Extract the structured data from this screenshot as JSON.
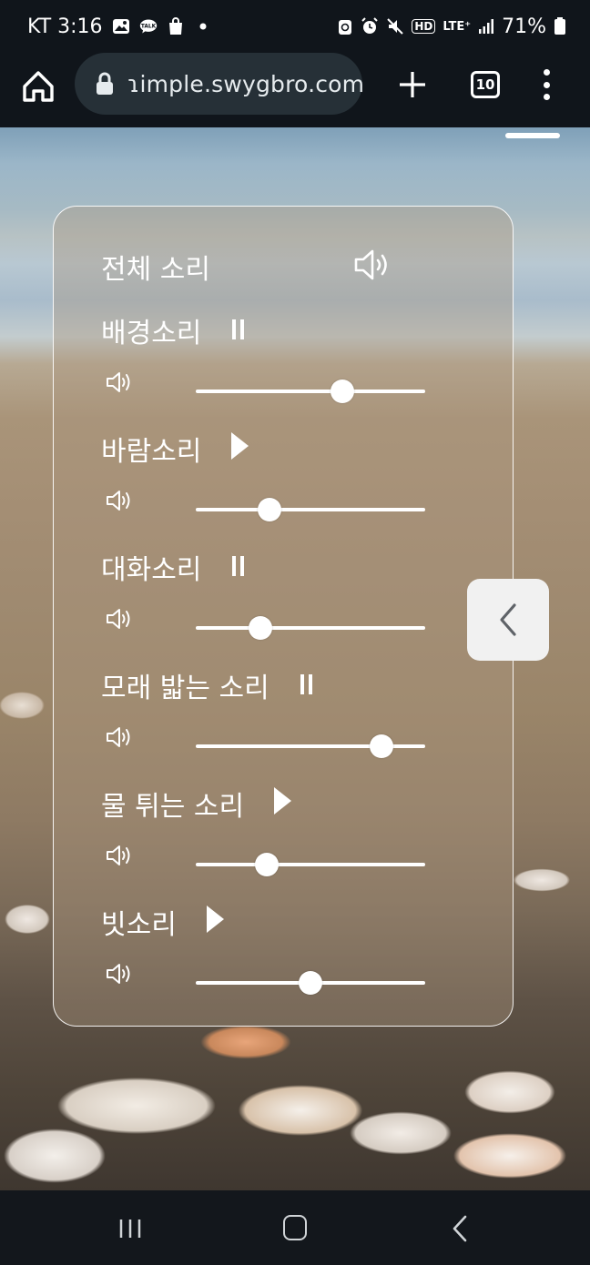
{
  "status_bar": {
    "carrier_time": "KT 3:16",
    "left_icons": [
      "gallery-icon",
      "talk-icon",
      "shopping-bag-icon",
      "dot-icon"
    ],
    "talk_badge": "TALK",
    "network_type": "LTE⁺",
    "hd_badge": "HD",
    "battery": "71%"
  },
  "browser": {
    "url": "ɿimple.swygbro.com",
    "tab_count": "10"
  },
  "sound_panel": {
    "master_label": "전체 소리",
    "tracks": [
      {
        "label": "배경소리",
        "state": "pause",
        "volume": 0.64
      },
      {
        "label": "바람소리",
        "state": "play",
        "volume": 0.32
      },
      {
        "label": "대화소리",
        "state": "pause",
        "volume": 0.28
      },
      {
        "label": "모래 밟는 소리",
        "state": "pause",
        "volume": 0.81
      },
      {
        "label": "물 튀는 소리",
        "state": "play",
        "volume": 0.31
      },
      {
        "label": "빗소리",
        "state": "play",
        "volume": 0.5
      }
    ]
  },
  "colors": {
    "status_bg": "#10151b",
    "url_pill_bg": "#263037",
    "panel_border": "#ffffff",
    "collapse_btn_bg": "#f1f1f1",
    "nav_bg": "#13171c"
  }
}
